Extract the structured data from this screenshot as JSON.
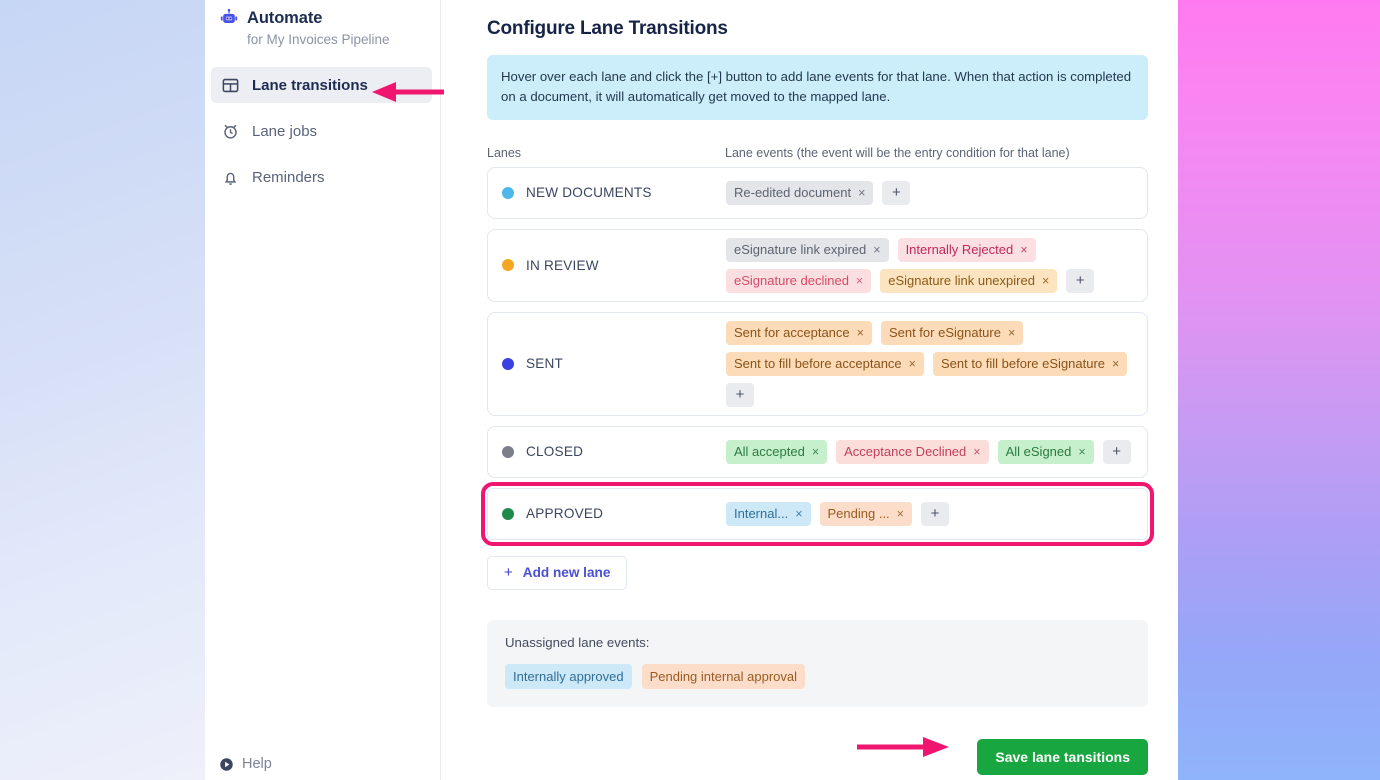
{
  "sidebar": {
    "brand": {
      "icon": "robot-icon",
      "title": "Automate",
      "subtitle": "for My Invoices Pipeline"
    },
    "items": [
      {
        "icon": "layout-panel-icon",
        "label": "Lane transitions",
        "active": true
      },
      {
        "icon": "alarm-clock-icon",
        "label": "Lane jobs",
        "active": false
      },
      {
        "icon": "bell-icon",
        "label": "Reminders",
        "active": false
      }
    ],
    "help": {
      "icon": "play-circle-icon",
      "label": "Help"
    }
  },
  "main": {
    "page_title": "Configure Lane Transitions",
    "info_banner": "Hover over each lane and click the [+] button to add lane events for that lane. When that action is completed on a document, it will automatically get moved to the mapped lane.",
    "columns": {
      "lanes": "Lanes",
      "events": "Lane events (the event will be the entry condition for that lane)"
    },
    "lanes": [
      {
        "name": "NEW DOCUMENTS",
        "dot_color": "#4cb7e8",
        "highlighted": false,
        "events": [
          {
            "label": "Re-edited document",
            "close": "×",
            "style": "gray"
          }
        ],
        "add_label": "+"
      },
      {
        "name": "IN REVIEW",
        "dot_color": "#f5a623",
        "highlighted": false,
        "events": [
          {
            "label": "eSignature link expired",
            "close": "×",
            "style": "gray"
          },
          {
            "label": "Internally Rejected",
            "close": "×",
            "style": "red"
          },
          {
            "label": "eSignature declined",
            "close": "×",
            "style": "pink"
          },
          {
            "label": "eSignature link unexpired",
            "close": "×",
            "style": "amber"
          }
        ],
        "add_label": "+"
      },
      {
        "name": "SENT",
        "dot_color": "#3a41e0",
        "highlighted": false,
        "events": [
          {
            "label": "Sent for acceptance",
            "close": "×",
            "style": "orange"
          },
          {
            "label": "Sent for eSignature",
            "close": "×",
            "style": "orange"
          },
          {
            "label": "Sent to fill before acceptance",
            "close": "×",
            "style": "orange"
          },
          {
            "label": "Sent to fill before eSignature",
            "close": "×",
            "style": "orange"
          }
        ],
        "add_label": "+"
      },
      {
        "name": "CLOSED",
        "dot_color": "#7b7f8a",
        "highlighted": false,
        "events": [
          {
            "label": "All accepted",
            "close": "×",
            "style": "green"
          },
          {
            "label": "Acceptance Declined",
            "close": "×",
            "style": "rose"
          },
          {
            "label": "All eSigned",
            "close": "×",
            "style": "green"
          }
        ],
        "add_label": "+"
      },
      {
        "name": "APPROVED",
        "dot_color": "#1f8a4c",
        "highlighted": true,
        "events": [
          {
            "label": "Internal...",
            "close": "×",
            "style": "blue"
          },
          {
            "label": "Pending ...",
            "close": "×",
            "style": "peach"
          }
        ],
        "add_label": "+"
      }
    ],
    "add_new_lane": {
      "plus": "+",
      "label": "Add new lane"
    },
    "unassigned": {
      "label": "Unassigned lane events:",
      "tags": [
        {
          "label": "Internally approved",
          "style": "blue"
        },
        {
          "label": "Pending internal approval",
          "style": "peach"
        }
      ]
    },
    "save_button": "Save lane tansitions"
  },
  "annotations": {
    "arrow_color": "#f0156e",
    "highlight_color": "#f0156e"
  }
}
